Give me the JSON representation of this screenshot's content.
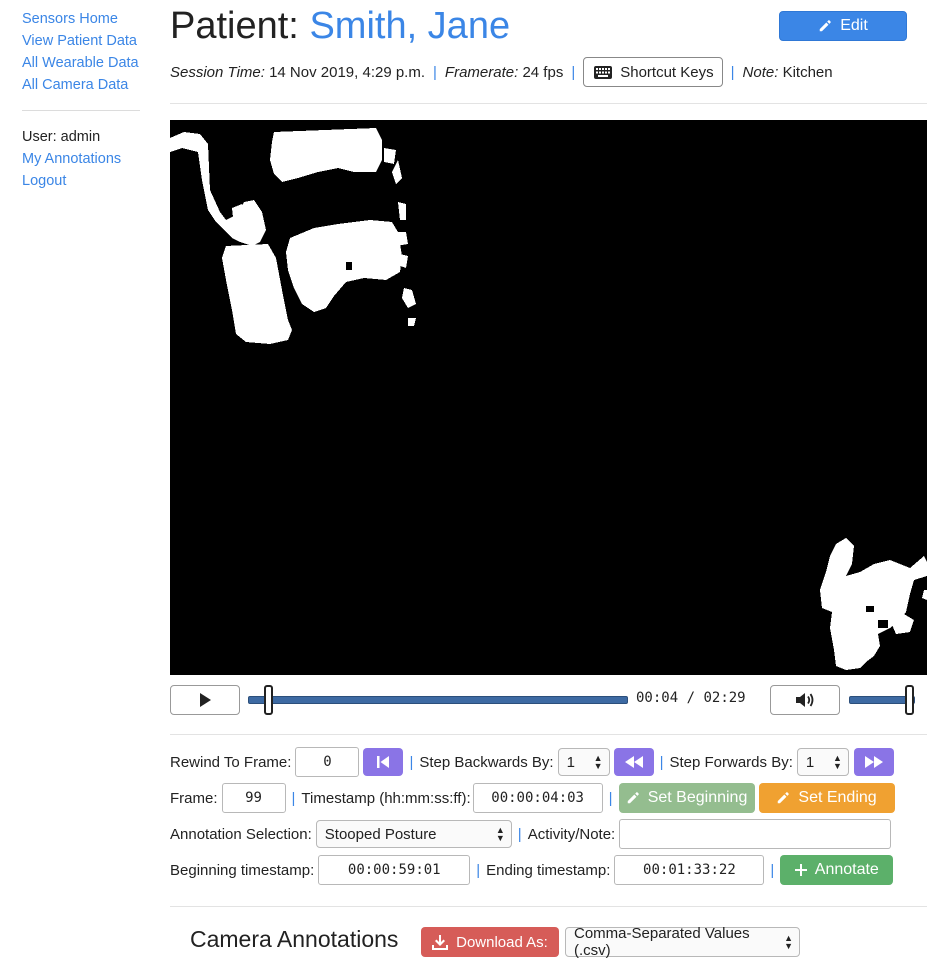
{
  "sidebar": {
    "links": [
      "Sensors Home",
      "View Patient Data",
      "All Wearable Data",
      "All Camera Data"
    ],
    "user_label": "User: admin",
    "account_links": [
      "My Annotations",
      "Logout"
    ]
  },
  "header": {
    "prefix": "Patient:",
    "patient_name": "Smith, Jane",
    "edit_label": "Edit"
  },
  "meta": {
    "session_time_label": "Session Time:",
    "session_time_value": "14 Nov 2019, 4:29 p.m.",
    "framerate_label": "Framerate:",
    "framerate_value": "24 fps",
    "shortcut_label": "Shortcut Keys",
    "note_label": "Note:",
    "note_value": "Kitchen"
  },
  "player": {
    "time_current": "00:04",
    "time_separator": "/",
    "time_total": "02:29",
    "progress_fraction": 0.04,
    "volume_fraction": 1.0
  },
  "navigation": {
    "rewind_label": "Rewind To Frame:",
    "rewind_value": "0",
    "step_back_label": "Step Backwards By:",
    "step_back_value": "1",
    "step_fwd_label": "Step Forwards By:",
    "step_fwd_value": "1"
  },
  "frame_info": {
    "frame_label": "Frame:",
    "frame_value": "99",
    "timestamp_label": "Timestamp (hh:mm:ss:ff):",
    "timestamp_value": "00:00:04:03",
    "set_beginning_label": "Set Beginning",
    "set_ending_label": "Set Ending"
  },
  "annotation": {
    "selection_label": "Annotation Selection:",
    "selection_value": "Stooped Posture",
    "activity_label": "Activity/Note:",
    "activity_value": "",
    "beginning_label": "Beginning timestamp:",
    "beginning_value": "00:00:59:01",
    "ending_label": "Ending timestamp:",
    "ending_value": "00:01:33:22",
    "annotate_label": "Annotate"
  },
  "annotations_section": {
    "title": "Camera Annotations",
    "download_label": "Download As:",
    "format_value": "Comma-Separated Values (.csv)"
  },
  "colors": {
    "link": "#3b86e6",
    "purple_button": "#8a74e6",
    "set_beginning": "#94bd8f",
    "set_ending": "#f0a131",
    "annotate": "#5cb06a",
    "download": "#d65c58"
  }
}
